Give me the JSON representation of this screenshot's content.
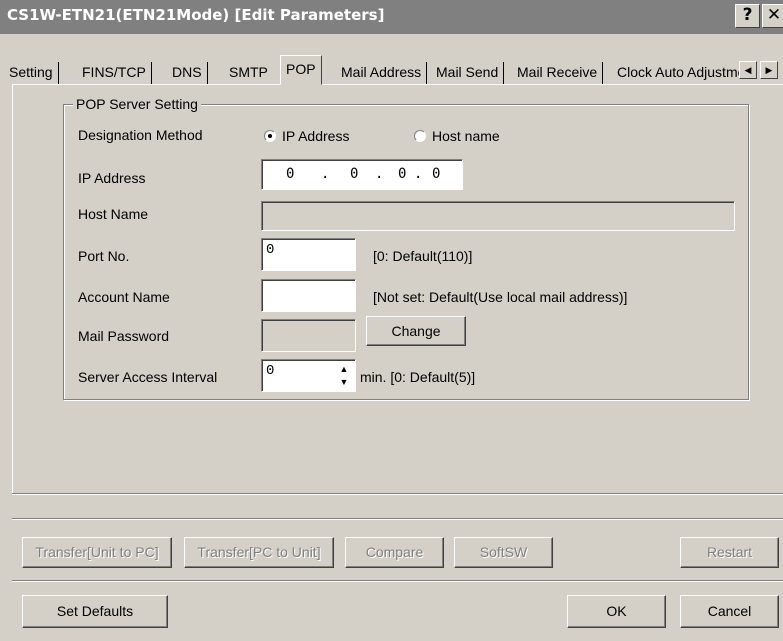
{
  "window": {
    "title": "CS1W-ETN21(ETN21Mode) [Edit Parameters]",
    "help_icon": "help-icon",
    "close_icon": "close-icon"
  },
  "tabs": [
    {
      "label": "Setting",
      "active": false
    },
    {
      "label": "FINS/TCP",
      "active": false
    },
    {
      "label": "DNS",
      "active": false
    },
    {
      "label": "SMTP",
      "active": false
    },
    {
      "label": "POP",
      "active": true
    },
    {
      "label": "Mail Address",
      "active": false
    },
    {
      "label": "Mail Send",
      "active": false
    },
    {
      "label": "Mail Receive",
      "active": false
    },
    {
      "label": "Clock Auto Adjustme",
      "active": false
    }
  ],
  "pop": {
    "group_title": "POP Server Setting",
    "designation_label": "Designation Method",
    "radio_ip_label": "IP Address",
    "radio_host_label": "Host name",
    "radio_selected": "IP Address",
    "ip_label": "IP Address",
    "ip_octets": [
      "0",
      "0",
      "0",
      "0"
    ],
    "ip_sep": ".",
    "host_label": "Host Name",
    "host_value": "",
    "port_label": "Port No.",
    "port_value": "0",
    "port_hint": "[0: Default(110)]",
    "account_label": "Account Name",
    "account_value": "",
    "account_hint": "[Not set: Default(Use local mail address)]",
    "password_label": "Mail Password",
    "password_value": "",
    "change_button": "Change",
    "interval_label": "Server Access Interval",
    "interval_value": "0",
    "interval_hint": "min. [0: Default(5)]"
  },
  "actions": {
    "transfer_unit_to_pc": "Transfer[Unit to PC]",
    "transfer_pc_to_unit": "Transfer[PC to Unit]",
    "compare": "Compare",
    "softsw": "SoftSW",
    "restart": "Restart",
    "set_defaults": "Set Defaults",
    "ok": "OK",
    "cancel": "Cancel"
  },
  "colors": {
    "titlebar_inactive": "#808080",
    "face": "#d4d0c8"
  }
}
